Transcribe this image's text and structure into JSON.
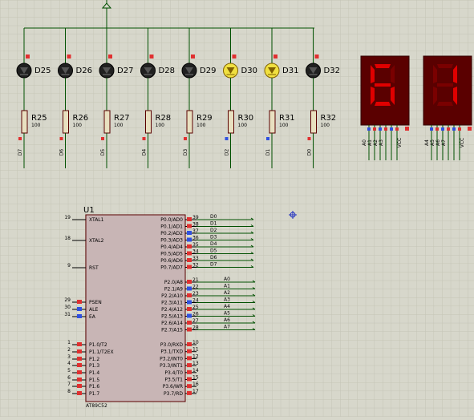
{
  "leds": [
    {
      "name": "D25",
      "resistor": "R25",
      "value": "100",
      "net": "D7",
      "lit": false
    },
    {
      "name": "D26",
      "resistor": "R26",
      "value": "100",
      "net": "D6",
      "lit": false
    },
    {
      "name": "D27",
      "resistor": "R27",
      "value": "100",
      "net": "D5",
      "lit": false
    },
    {
      "name": "D28",
      "resistor": "R28",
      "value": "100",
      "net": "D4",
      "lit": false
    },
    {
      "name": "D29",
      "resistor": "R29",
      "value": "100",
      "net": "D3",
      "lit": false
    },
    {
      "name": "D30",
      "resistor": "R30",
      "value": "100",
      "net": "D2",
      "lit": true
    },
    {
      "name": "D31",
      "resistor": "R31",
      "value": "100",
      "net": "D1",
      "lit": true
    },
    {
      "name": "D32",
      "resistor": "R32",
      "value": "100",
      "net": "D0",
      "lit": false
    }
  ],
  "displays": [
    {
      "digit": "6",
      "pins": [
        "A0",
        "A1",
        "A2",
        "A3",
        "VCC"
      ]
    },
    {
      "digit": "1",
      "pins": [
        "A4",
        "A5",
        "A6",
        "A7",
        "VCC"
      ]
    }
  ],
  "mcu": {
    "ref": "U1",
    "part": "AT89C52",
    "left_pins": [
      {
        "num": "19",
        "name": "XTAL1"
      },
      {
        "num": "18",
        "name": "XTAL2"
      },
      {
        "num": "9",
        "name": "RST"
      },
      {
        "num": "29",
        "name": "PSEN"
      },
      {
        "num": "30",
        "name": "ALE"
      },
      {
        "num": "31",
        "name": "EA"
      },
      {
        "num": "1",
        "name": "P1.0/T2"
      },
      {
        "num": "2",
        "name": "P1.1/T2EX"
      },
      {
        "num": "3",
        "name": "P1.2"
      },
      {
        "num": "4",
        "name": "P1.3"
      },
      {
        "num": "5",
        "name": "P1.4"
      },
      {
        "num": "6",
        "name": "P1.5"
      },
      {
        "num": "7",
        "name": "P1.6"
      },
      {
        "num": "8",
        "name": "P1.7"
      }
    ],
    "port0": [
      {
        "num": "39",
        "name": "P0.0/AD0",
        "net": "D0"
      },
      {
        "num": "38",
        "name": "P0.1/AD1",
        "net": "D1"
      },
      {
        "num": "37",
        "name": "P0.2/AD2",
        "net": "D2"
      },
      {
        "num": "36",
        "name": "P0.3/AD3",
        "net": "D3"
      },
      {
        "num": "35",
        "name": "P0.4/AD4",
        "net": "D4"
      },
      {
        "num": "34",
        "name": "P0.5/AD5",
        "net": "D5"
      },
      {
        "num": "33",
        "name": "P0.6/AD6",
        "net": "D6"
      },
      {
        "num": "32",
        "name": "P0.7/AD7",
        "net": "D7"
      }
    ],
    "port2": [
      {
        "num": "21",
        "name": "P2.0/A8",
        "net": "A0"
      },
      {
        "num": "22",
        "name": "P2.1/A9",
        "net": "A1"
      },
      {
        "num": "23",
        "name": "P2.2/A10",
        "net": "A2"
      },
      {
        "num": "24",
        "name": "P2.3/A11",
        "net": "A3"
      },
      {
        "num": "25",
        "name": "P2.4/A12",
        "net": "A4"
      },
      {
        "num": "26",
        "name": "P2.5/A13",
        "net": "A5"
      },
      {
        "num": "27",
        "name": "P2.6/A14",
        "net": "A6"
      },
      {
        "num": "28",
        "name": "P2.7/A15",
        "net": "A7"
      }
    ],
    "port3": [
      {
        "num": "10",
        "name": "P3.0/RXD"
      },
      {
        "num": "11",
        "name": "P3.1/TXD"
      },
      {
        "num": "12",
        "name": "P3.2/INT0"
      },
      {
        "num": "13",
        "name": "P3.3/INT1"
      },
      {
        "num": "14",
        "name": "P3.4/T0"
      },
      {
        "num": "15",
        "name": "P3.5/T1"
      },
      {
        "num": "16",
        "name": "P3.6/WR"
      },
      {
        "num": "17",
        "name": "P3.7/RD"
      }
    ]
  },
  "colors": {
    "grid": "#c7c7b9",
    "wire": "#005000",
    "body": "#c8b5b5",
    "outline": "#5a0000",
    "pin_red": "#e03030",
    "pin_blue": "#3050e0",
    "led_off": "#202020",
    "led_on": "#f0e040",
    "seg_on": "#e00000",
    "seg_off": "#7a0000",
    "display_bg": "#5a0000"
  }
}
